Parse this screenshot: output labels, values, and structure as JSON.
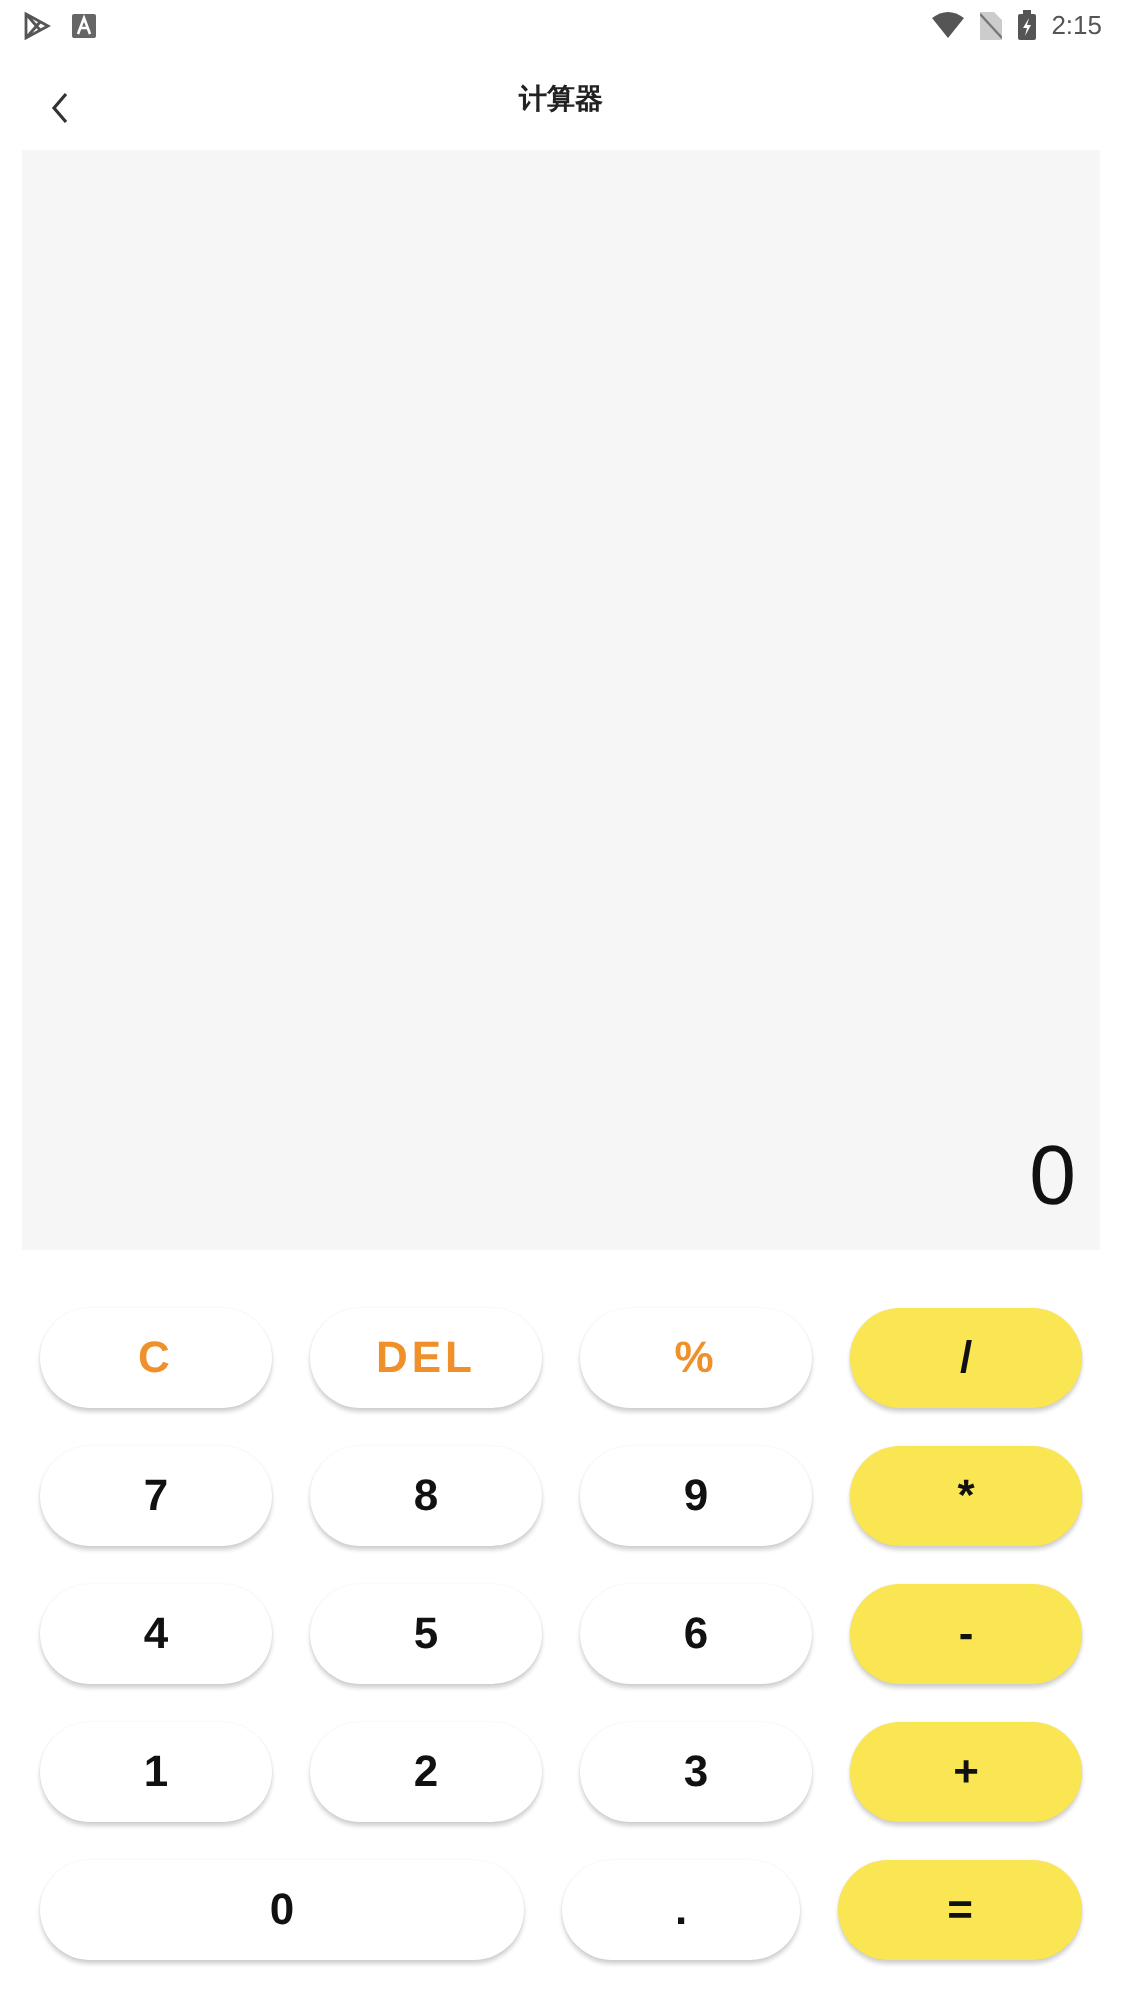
{
  "status_bar": {
    "time": "2:15"
  },
  "header": {
    "title": "计算器"
  },
  "display": {
    "value": "0"
  },
  "keypad": [
    [
      {
        "label": "C",
        "kind": "function"
      },
      {
        "label": "DEL",
        "kind": "function"
      },
      {
        "label": "%",
        "kind": "function"
      },
      {
        "label": "/",
        "kind": "operator"
      }
    ],
    [
      {
        "label": "7",
        "kind": "digit"
      },
      {
        "label": "8",
        "kind": "digit"
      },
      {
        "label": "9",
        "kind": "digit"
      },
      {
        "label": "*",
        "kind": "operator"
      }
    ],
    [
      {
        "label": "4",
        "kind": "digit"
      },
      {
        "label": "5",
        "kind": "digit"
      },
      {
        "label": "6",
        "kind": "digit"
      },
      {
        "label": "-",
        "kind": "operator"
      }
    ],
    [
      {
        "label": "1",
        "kind": "digit"
      },
      {
        "label": "2",
        "kind": "digit"
      },
      {
        "label": "3",
        "kind": "digit"
      },
      {
        "label": "+",
        "kind": "operator"
      }
    ],
    [
      {
        "label": "0",
        "kind": "digit"
      },
      {
        "label": ".",
        "kind": "digit"
      },
      {
        "label": "=",
        "kind": "operator"
      }
    ]
  ]
}
